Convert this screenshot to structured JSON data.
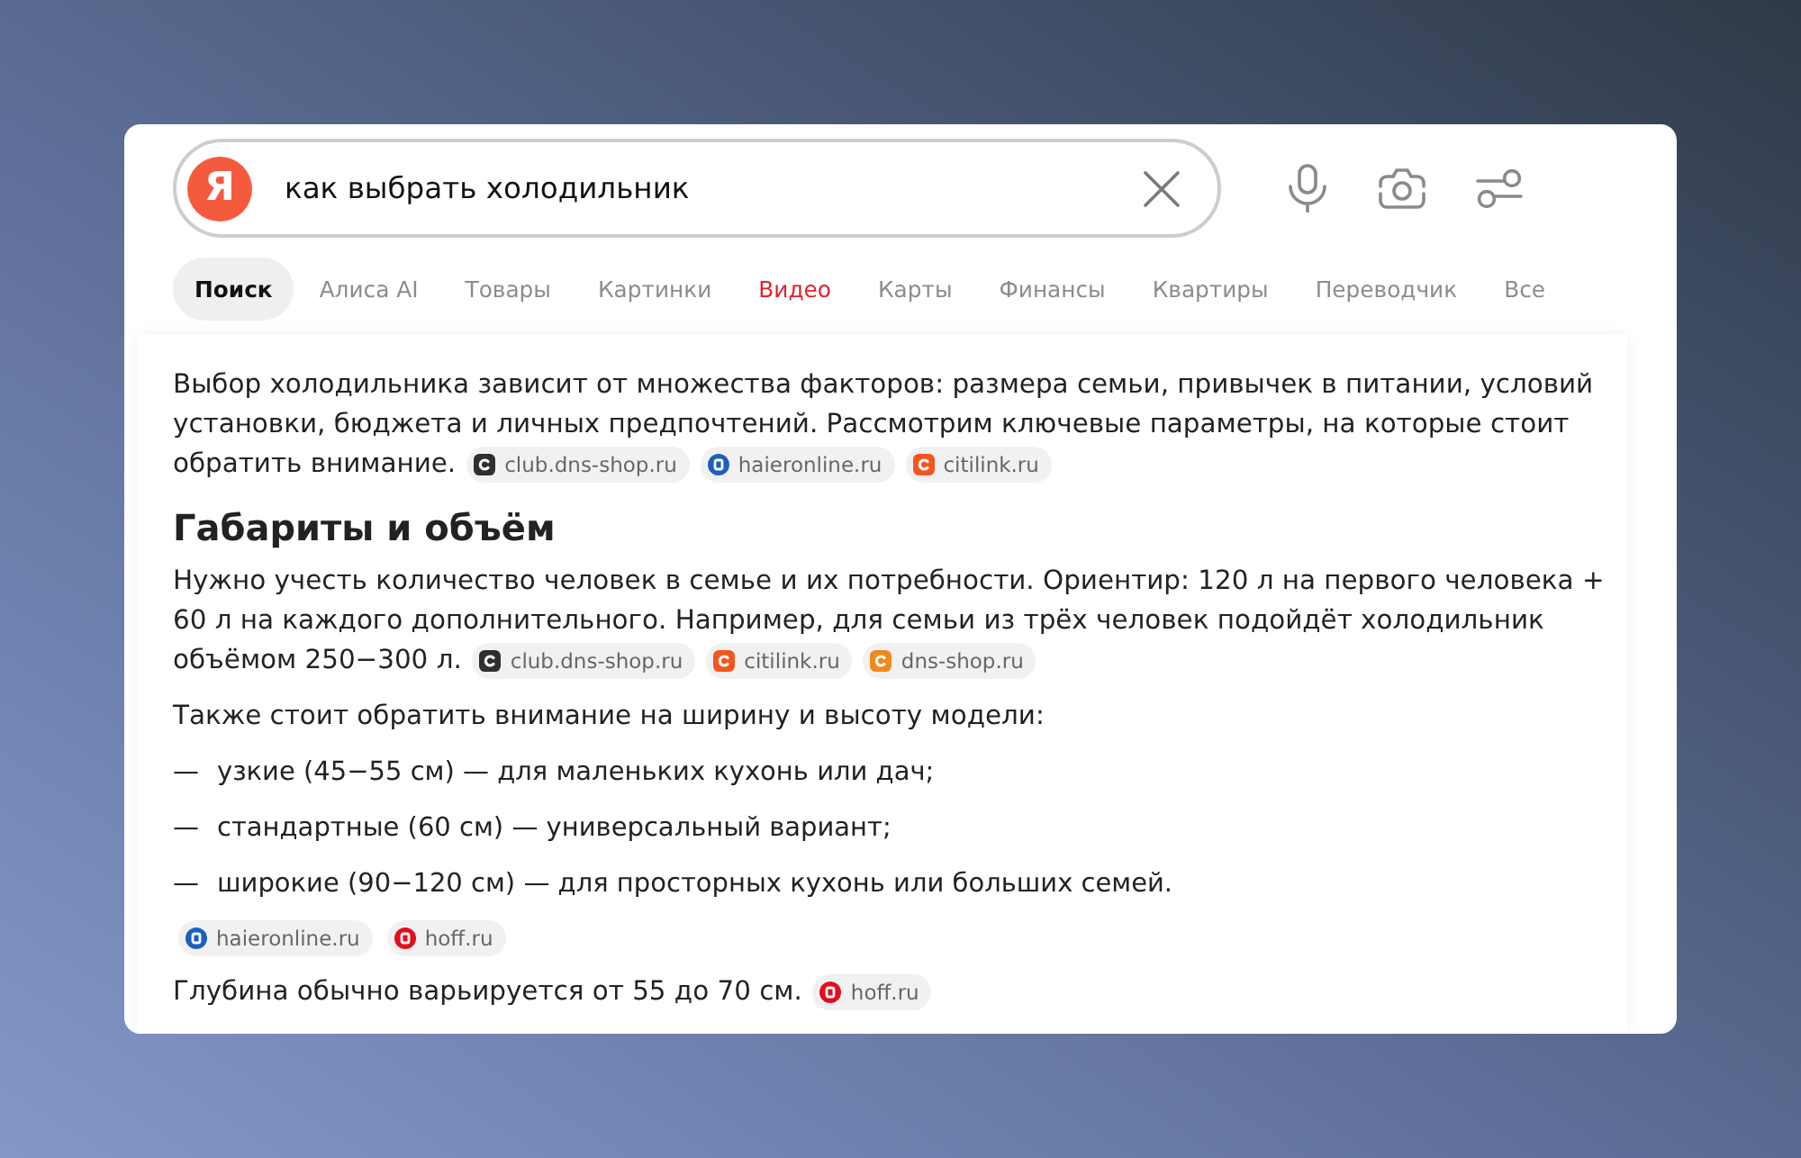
{
  "search": {
    "logo": "Я",
    "query": "как выбрать холодильник"
  },
  "tabs": [
    {
      "label": "Поиск",
      "selected": true,
      "kind": "plain"
    },
    {
      "label": "Алиса AI",
      "selected": false,
      "kind": "plain"
    },
    {
      "label": "Товары",
      "selected": false,
      "kind": "plain"
    },
    {
      "label": "Картинки",
      "selected": false,
      "kind": "plain"
    },
    {
      "label": "Видео",
      "selected": false,
      "kind": "accent"
    },
    {
      "label": "Карты",
      "selected": false,
      "kind": "plain"
    },
    {
      "label": "Финансы",
      "selected": false,
      "kind": "plain"
    },
    {
      "label": "Квартиры",
      "selected": false,
      "kind": "plain"
    },
    {
      "label": "Переводчик",
      "selected": false,
      "kind": "plain"
    },
    {
      "label": "Все",
      "selected": false,
      "kind": "plain"
    }
  ],
  "answer": {
    "blocks": [
      {
        "kind": "paragraph",
        "text": "Выбор холодильника зависит от множества факторов: размера семьи, привычек в питании, условий установки, бюджета и личных предпочтений. Рассмотрим ключевые параметры, на которые стоит обратить внимание.",
        "sources": [
          {
            "domain": "club.dns-shop.ru",
            "kind": "tile",
            "color": "#2f2f2f"
          },
          {
            "domain": "haieronline.ru",
            "kind": "circle",
            "color": "#1c5fc0"
          },
          {
            "domain": "citilink.ru",
            "kind": "tile",
            "color": "#f4561d"
          }
        ]
      },
      {
        "kind": "heading",
        "text": "Габариты и объём"
      },
      {
        "kind": "paragraph",
        "text": "Нужно учесть количество человек в семье и их потребности. Ориентир: 120 л на первого человека + 60 л на каждого дополнительного. Например, для семьи из трёх человек подойдёт холодильник объёмом 250−300 л.",
        "sources": [
          {
            "domain": "club.dns-shop.ru",
            "kind": "tile",
            "color": "#2f2f2f"
          },
          {
            "domain": "citilink.ru",
            "kind": "tile",
            "color": "#f4561d"
          },
          {
            "domain": "dns-shop.ru",
            "kind": "tile",
            "color": "#f08a1c"
          }
        ]
      },
      {
        "kind": "paragraph",
        "text": "Также стоит обратить внимание на ширину и высоту модели:"
      },
      {
        "kind": "list",
        "items": [
          {
            "marker": "—",
            "text": "узкие (45−55 см) — для маленьких кухонь или дач;"
          },
          {
            "marker": "—",
            "text": "стандартные (60 см) — универсальный вариант;"
          },
          {
            "marker": "—",
            "text": "широкие (90−120 см) — для просторных кухонь или больших семей."
          }
        ]
      },
      {
        "kind": "sources",
        "sources": [
          {
            "domain": "haieronline.ru",
            "kind": "circle",
            "color": "#1c5fc0"
          },
          {
            "domain": "hoff.ru",
            "kind": "circle",
            "color": "#e30e1e"
          }
        ]
      },
      {
        "kind": "paragraph",
        "text": "Глубина обычно варьируется от 55 до 70 см.",
        "sources": [
          {
            "domain": "hoff.ru",
            "kind": "circle",
            "color": "#e30e1e"
          }
        ]
      }
    ]
  }
}
